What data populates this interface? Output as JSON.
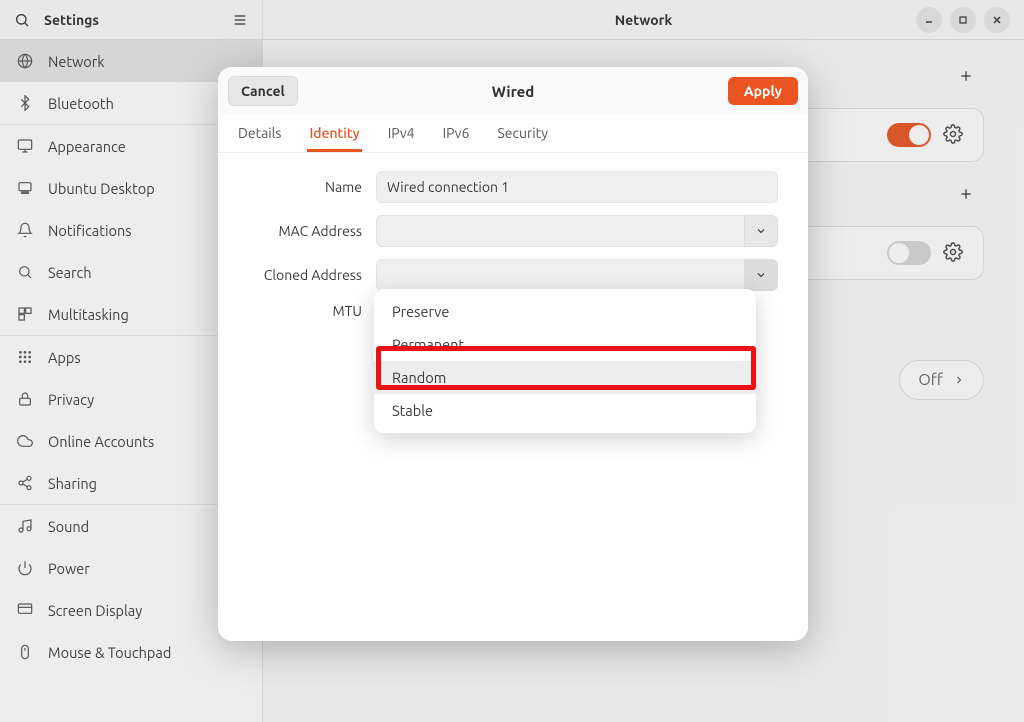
{
  "topbar": {
    "settings_title": "Settings",
    "page_title": "Network"
  },
  "sidebar": {
    "items": [
      {
        "label": "Network",
        "icon": "globe",
        "active": true
      },
      {
        "label": "Bluetooth",
        "icon": "bluetooth",
        "active": false
      },
      {
        "sep": true
      },
      {
        "label": "Appearance",
        "icon": "display",
        "active": false
      },
      {
        "label": "Ubuntu Desktop",
        "icon": "desktop",
        "active": false
      },
      {
        "label": "Notifications",
        "icon": "bell",
        "active": false
      },
      {
        "label": "Search",
        "icon": "search",
        "active": false
      },
      {
        "label": "Multitasking",
        "icon": "windows",
        "active": false
      },
      {
        "sep": true
      },
      {
        "label": "Apps",
        "icon": "grid",
        "active": false
      },
      {
        "label": "Privacy",
        "icon": "lock",
        "active": false
      },
      {
        "label": "Online Accounts",
        "icon": "cloud",
        "active": false
      },
      {
        "label": "Sharing",
        "icon": "share",
        "active": false
      },
      {
        "sep": true
      },
      {
        "label": "Sound",
        "icon": "music",
        "active": false
      },
      {
        "label": "Power",
        "icon": "power",
        "active": false
      },
      {
        "label": "Screen Display",
        "icon": "monitor",
        "active": false
      },
      {
        "label": "Mouse & Touchpad",
        "icon": "mouse",
        "active": false
      }
    ]
  },
  "content": {
    "off_label": "Off"
  },
  "dialog": {
    "cancel": "Cancel",
    "apply": "Apply",
    "title": "Wired",
    "tabs": [
      "Details",
      "Identity",
      "IPv4",
      "IPv6",
      "Security"
    ],
    "active_tab": "Identity",
    "labels": {
      "name": "Name",
      "mac": "MAC Address",
      "cloned": "Cloned Address",
      "mtu": "MTU"
    },
    "values": {
      "name": "Wired connection 1",
      "mac": "",
      "cloned": ""
    },
    "dropdown": [
      "Preserve",
      "Permanent",
      "Random",
      "Stable"
    ],
    "hovered_option": "Random"
  }
}
